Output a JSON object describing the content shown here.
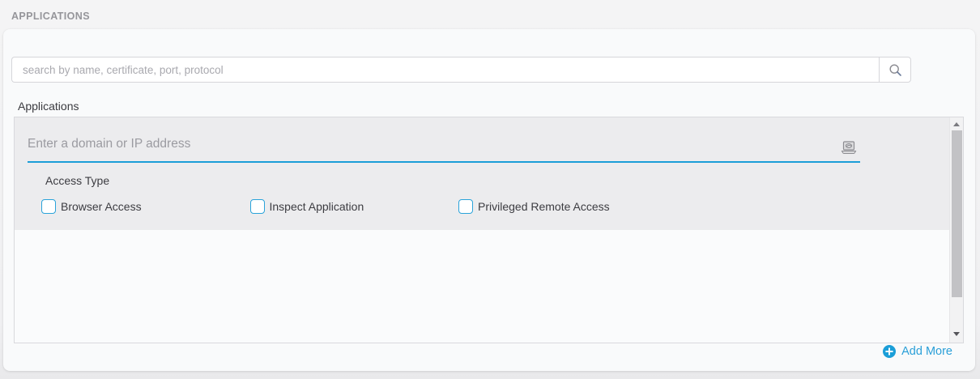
{
  "page": {
    "title": "APPLICATIONS"
  },
  "search": {
    "placeholder": "search by name, certificate, port, protocol"
  },
  "applications_section": {
    "label": "Applications"
  },
  "app_form": {
    "domain_input": {
      "value": "",
      "placeholder": "Enter a domain or IP address"
    },
    "access_type": {
      "label": "Access Type",
      "options": [
        {
          "label": "Browser Access",
          "checked": false
        },
        {
          "label": "Inspect Application",
          "checked": false
        },
        {
          "label": "Privileged Remote Access",
          "checked": false
        }
      ]
    }
  },
  "footer": {
    "add_more_label": "Add More"
  },
  "icons": {
    "search": "magnifier-icon",
    "domain_field": "laptop-icon",
    "add_more": "plus-circle-icon",
    "scrollbar": [
      "scroll-up-arrow",
      "scroll-down-arrow"
    ]
  },
  "colors": {
    "accent_underline": "#1b9ed8",
    "checkbox_border": "#2aa3da",
    "link_blue": "#2a9fd8",
    "row_gray": "#ececee",
    "card_bg": "#f9fafb"
  }
}
